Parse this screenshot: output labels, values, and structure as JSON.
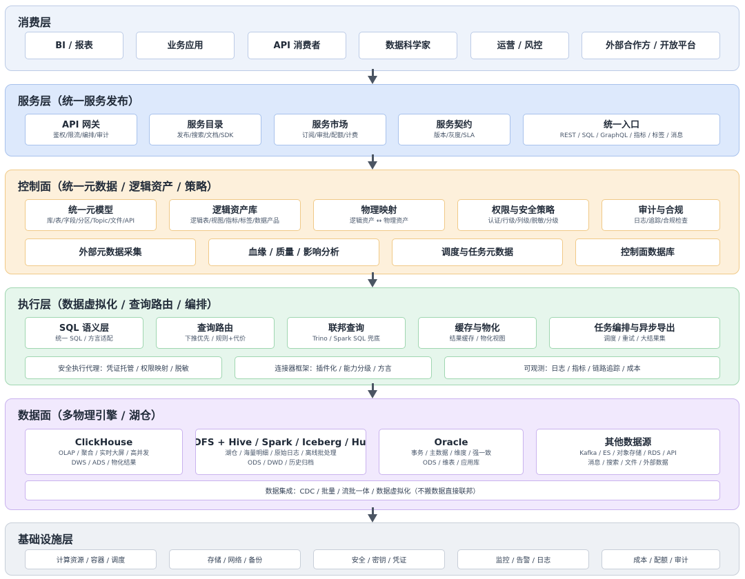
{
  "consumption": {
    "title": "消费层",
    "items": [
      "BI / 报表",
      "业务应用",
      "API 消费者",
      "数据科学家",
      "运营 / 风控",
      "外部合作方 / 开放平台"
    ]
  },
  "service": {
    "title": "服务层（统一服务发布）",
    "items": [
      {
        "title": "API 网关",
        "sub": "鉴权/限流/编排/审计"
      },
      {
        "title": "服务目录",
        "sub": "发布/搜索/文档/SDK"
      },
      {
        "title": "服务市场",
        "sub": "订阅/审批/配额/计费"
      },
      {
        "title": "服务契约",
        "sub": "版本/灰度/SLA"
      },
      {
        "title": "统一入口",
        "sub": "REST / SQL / GraphQL / 指标 / 标签 / 消息"
      }
    ]
  },
  "control": {
    "title": "控制面（统一元数据 / 逻辑资产 / 策略）",
    "row1": [
      {
        "title": "统一元模型",
        "sub": "库/表/字段/分区/Topic/文件/API"
      },
      {
        "title": "逻辑资产库",
        "sub": "逻辑表/视图/指标/标签/数据产品"
      },
      {
        "title": "物理映射",
        "sub": "逻辑资产 ↔ 物理资产"
      },
      {
        "title": "权限与安全策略",
        "sub": "认证/行级/列级/脱敏/分级"
      },
      {
        "title": "审计与合规",
        "sub": "日志/追踪/合规检查"
      }
    ],
    "row2": [
      "外部元数据采集",
      "血缘 / 质量 / 影响分析",
      "调度与任务元数据",
      "控制面数据库"
    ]
  },
  "execution": {
    "title": "执行层（数据虚拟化 / 查询路由 / 编排）",
    "row1": [
      {
        "title": "SQL 语义层",
        "sub": "统一 SQL / 方言适配"
      },
      {
        "title": "查询路由",
        "sub": "下推优先 / 规则+代价"
      },
      {
        "title": "联邦查询",
        "sub": "Trino / Spark SQL 兜底"
      },
      {
        "title": "缓存与物化",
        "sub": "结果缓存 / 物化视图"
      },
      {
        "title": "任务编排与异步导出",
        "sub": "调度 / 重试 / 大结果集"
      }
    ],
    "row2": [
      "安全执行代理：凭证托管 / 权限映射 / 脱敏",
      "连接器框架：插件化 / 能力分级 / 方言",
      "可观测：日志 / 指标 / 链路追踪 / 成本"
    ]
  },
  "dataplane": {
    "title": "数据面（多物理引擎 / 湖仓）",
    "items": [
      {
        "title": "ClickHouse",
        "sub1": "OLAP / 聚合 / 实时大屏 / 高并发",
        "sub2": "DWS / ADS / 物化结果"
      },
      {
        "title": "HDFS + Hive / Spark / Iceberg / Hudi",
        "sub1": "湖仓 / 海量明细 / 原始日志 / 离线批处理",
        "sub2": "ODS / DWD / 历史归档"
      },
      {
        "title": "Oracle",
        "sub1": "事务 / 主数据 / 维度 / 强一致",
        "sub2": "ODS / 维表 / 应用库"
      },
      {
        "title": "其他数据源",
        "sub1": "Kafka / ES / 对象存储 / RDS / API",
        "sub2": "消息 / 搜索 / 文件 / 外部数据"
      }
    ],
    "integration": "数据集成：CDC / 批量 / 流批一体 / 数据虚拟化（不搬数据直接联邦）"
  },
  "infra": {
    "title": "基础设施层",
    "items": [
      "计算资源 / 容器 / 调度",
      "存储 / 网络 / 备份",
      "安全 / 密钥 / 凭证",
      "监控 / 告警 / 日志",
      "成本 / 配额 / 审计"
    ]
  }
}
